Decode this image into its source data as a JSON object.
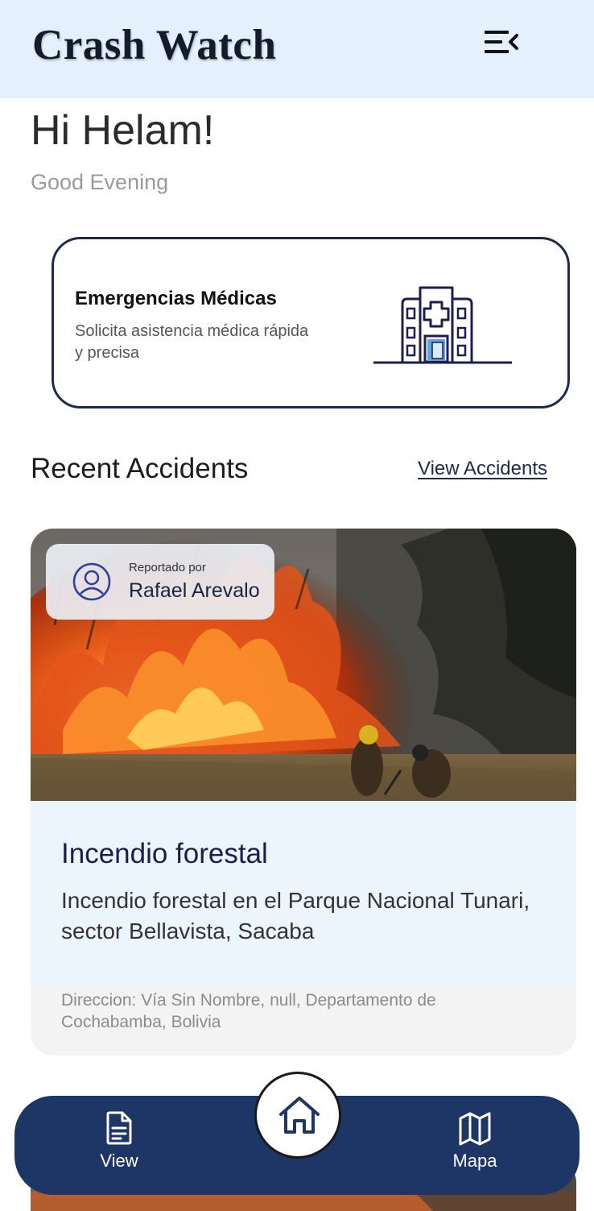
{
  "app": {
    "title": "Crash Watch"
  },
  "header": {
    "menu_icon": "menu-collapse-icon"
  },
  "greeting": {
    "hello": "Hi Helam!",
    "time_of_day": "Good Evening"
  },
  "emergency_card": {
    "title": "Emergencias Médicas",
    "description": "Solicita asistencia médica rápida y precisa",
    "icon": "hospital-icon"
  },
  "recent": {
    "title": "Recent Accidents",
    "view_all_label": "View Accidents"
  },
  "accidents": [
    {
      "reported_by_label": "Reportado por",
      "reporter": "Rafael Arevalo",
      "title": "Incendio forestal",
      "description": "Incendio forestal en el Parque Nacional Tunari, sector Bellavista, Sacaba",
      "address": "Direccion: Vía Sin Nombre, null, Departamento de Cochabamba, Bolivia"
    }
  ],
  "bottom_nav": {
    "items": [
      {
        "label": "View",
        "icon": "document-icon"
      },
      {
        "label": "Mapa",
        "icon": "map-icon"
      }
    ],
    "home_icon": "home-icon"
  },
  "colors": {
    "header_bg": "#e4f1fc",
    "nav_bg": "#1e3666",
    "card_border": "#1d2b4a",
    "accident_body_bg": "#ecf4fd"
  }
}
